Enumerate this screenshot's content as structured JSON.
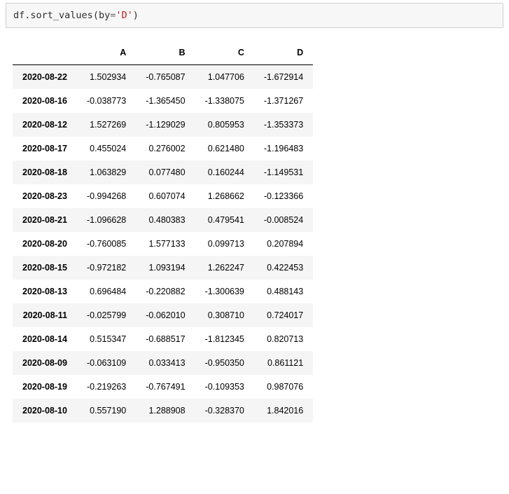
{
  "code": {
    "object": "df",
    "method": "sort_values",
    "kwarg": "by",
    "arg_value": "'D'"
  },
  "table": {
    "columns": [
      "A",
      "B",
      "C",
      "D"
    ],
    "rows": [
      {
        "index": "2020-08-22",
        "values": [
          "1.502934",
          "-0.765087",
          "1.047706",
          "-1.672914"
        ]
      },
      {
        "index": "2020-08-16",
        "values": [
          "-0.038773",
          "-1.365450",
          "-1.338075",
          "-1.371267"
        ]
      },
      {
        "index": "2020-08-12",
        "values": [
          "1.527269",
          "-1.129029",
          "0.805953",
          "-1.353373"
        ]
      },
      {
        "index": "2020-08-17",
        "values": [
          "0.455024",
          "0.276002",
          "0.621480",
          "-1.196483"
        ]
      },
      {
        "index": "2020-08-18",
        "values": [
          "1.063829",
          "0.077480",
          "0.160244",
          "-1.149531"
        ]
      },
      {
        "index": "2020-08-23",
        "values": [
          "-0.994268",
          "0.607074",
          "1.268662",
          "-0.123366"
        ]
      },
      {
        "index": "2020-08-21",
        "values": [
          "-1.096628",
          "0.480383",
          "0.479541",
          "-0.008524"
        ]
      },
      {
        "index": "2020-08-20",
        "values": [
          "-0.760085",
          "1.577133",
          "0.099713",
          "0.207894"
        ]
      },
      {
        "index": "2020-08-15",
        "values": [
          "-0.972182",
          "1.093194",
          "1.262247",
          "0.422453"
        ]
      },
      {
        "index": "2020-08-13",
        "values": [
          "0.696484",
          "-0.220882",
          "-1.300639",
          "0.488143"
        ]
      },
      {
        "index": "2020-08-11",
        "values": [
          "-0.025799",
          "-0.062010",
          "0.308710",
          "0.724017"
        ]
      },
      {
        "index": "2020-08-14",
        "values": [
          "0.515347",
          "-0.688517",
          "-1.812345",
          "0.820713"
        ]
      },
      {
        "index": "2020-08-09",
        "values": [
          "-0.063109",
          "0.033413",
          "-0.950350",
          "0.861121"
        ]
      },
      {
        "index": "2020-08-19",
        "values": [
          "-0.219263",
          "-0.767491",
          "-0.109353",
          "0.987076"
        ]
      },
      {
        "index": "2020-08-10",
        "values": [
          "0.557190",
          "1.288908",
          "-0.328370",
          "1.842016"
        ]
      }
    ]
  }
}
